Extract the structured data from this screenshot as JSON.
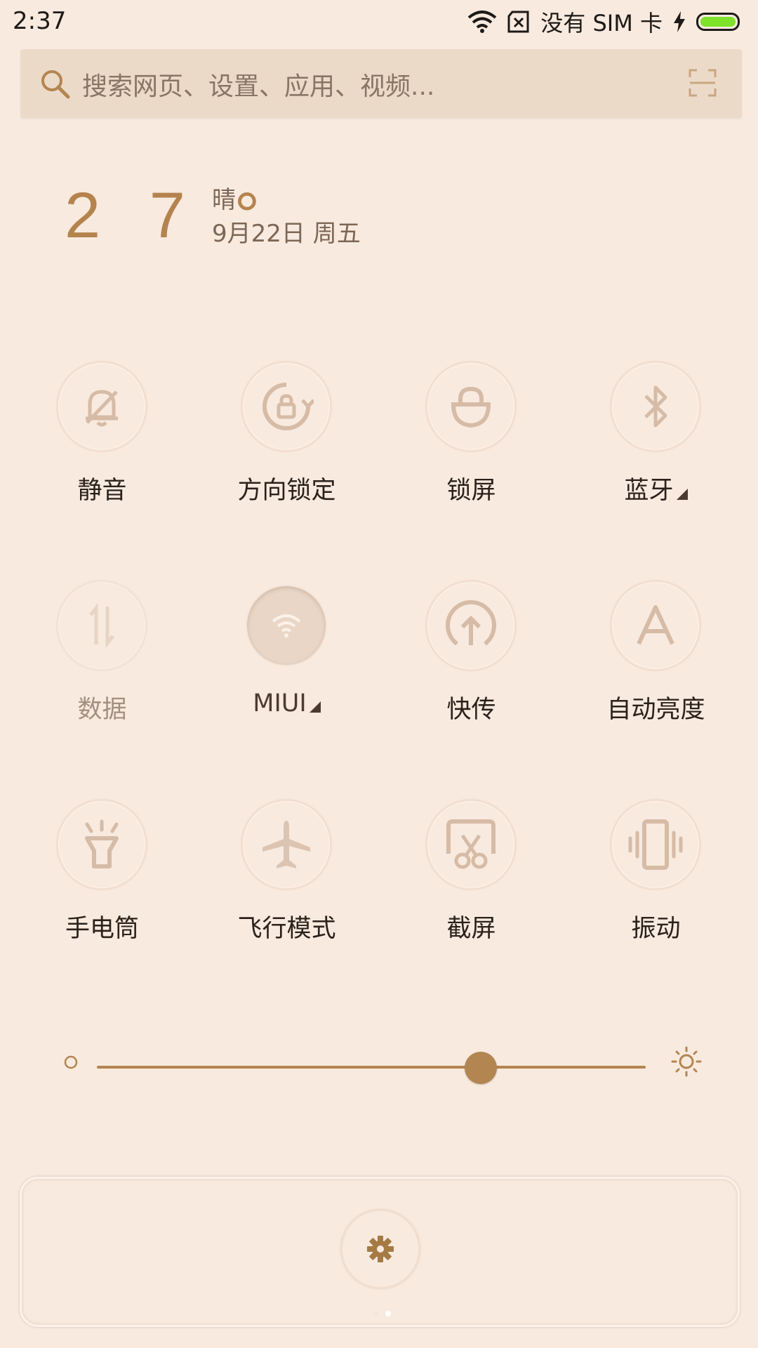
{
  "status_bar": {
    "time": "2:37",
    "carrier": "没有 SIM 卡"
  },
  "search": {
    "placeholder": "搜索网页、设置、应用、视频..."
  },
  "weather": {
    "temperature": "2 7 °",
    "condition": "晴",
    "date": "9月22日 周五"
  },
  "toggles": [
    {
      "label": "静音",
      "icon": "bell-off-icon",
      "active": false,
      "dim": false,
      "has_arrow": false
    },
    {
      "label": "方向锁定",
      "icon": "rotation-lock-icon",
      "active": false,
      "dim": false,
      "has_arrow": false
    },
    {
      "label": "锁屏",
      "icon": "lock-icon",
      "active": false,
      "dim": false,
      "has_arrow": false
    },
    {
      "label": "蓝牙",
      "icon": "bluetooth-icon",
      "active": false,
      "dim": false,
      "has_arrow": true
    },
    {
      "label": "数据",
      "icon": "mobile-data-icon",
      "active": false,
      "dim": true,
      "has_arrow": false
    },
    {
      "label": "MIUI",
      "icon": "wifi-icon",
      "active": true,
      "dim": false,
      "has_arrow": true
    },
    {
      "label": "快传",
      "icon": "quick-transfer-icon",
      "active": false,
      "dim": false,
      "has_arrow": false
    },
    {
      "label": "自动亮度",
      "icon": "auto-brightness-icon",
      "active": false,
      "dim": false,
      "has_arrow": false
    },
    {
      "label": "手电筒",
      "icon": "flashlight-icon",
      "active": false,
      "dim": false,
      "has_arrow": false
    },
    {
      "label": "飞行模式",
      "icon": "airplane-icon",
      "active": false,
      "dim": false,
      "has_arrow": false
    },
    {
      "label": "截屏",
      "icon": "screenshot-icon",
      "active": false,
      "dim": false,
      "has_arrow": false
    },
    {
      "label": "振动",
      "icon": "vibrate-icon",
      "active": false,
      "dim": false,
      "has_arrow": false
    }
  ],
  "brightness": {
    "level": 0.7
  },
  "colors": {
    "accent": "#b38550",
    "background": "#f8eadf",
    "battery": "#7ee12a"
  }
}
